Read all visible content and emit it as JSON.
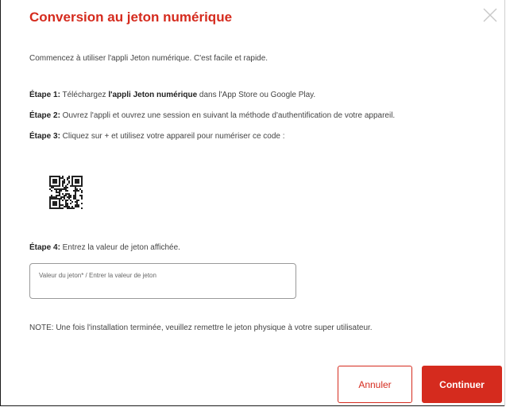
{
  "dialog": {
    "title": "Conversion au jeton numérique",
    "close_icon": "close-icon",
    "intro": "Commencez à utiliser l'appli Jeton numérique. C'est facile et rapide.",
    "steps": [
      {
        "label": "Étape 1:",
        "text_before": " Téléchargez ",
        "bold": "l'appli Jeton numérique",
        "text_after": " dans l'App Store ou Google Play."
      },
      {
        "label": "Étape 2:",
        "text": " Ouvrez l'appli et ouvrez une session en suivant la méthode d'authentification de votre appareil."
      },
      {
        "label": "Étape 3:",
        "text": " Cliquez sur + et utilisez votre appareil pour numériser ce code :"
      },
      {
        "label": "Étape 4:",
        "text": " Entrez la valeur de jeton affichée."
      }
    ],
    "qr_icon": "qr-code",
    "token_field": {
      "label": "Valeur du jeton* / Entrer la valeur de jeton",
      "value": ""
    },
    "note": "NOTE: Une fois l'installation terminée, veuillez remettre le jeton physique à votre super utilisateur.",
    "buttons": {
      "cancel": "Annuler",
      "continue": "Continuer"
    },
    "colors": {
      "accent": "#d52b1e"
    }
  }
}
